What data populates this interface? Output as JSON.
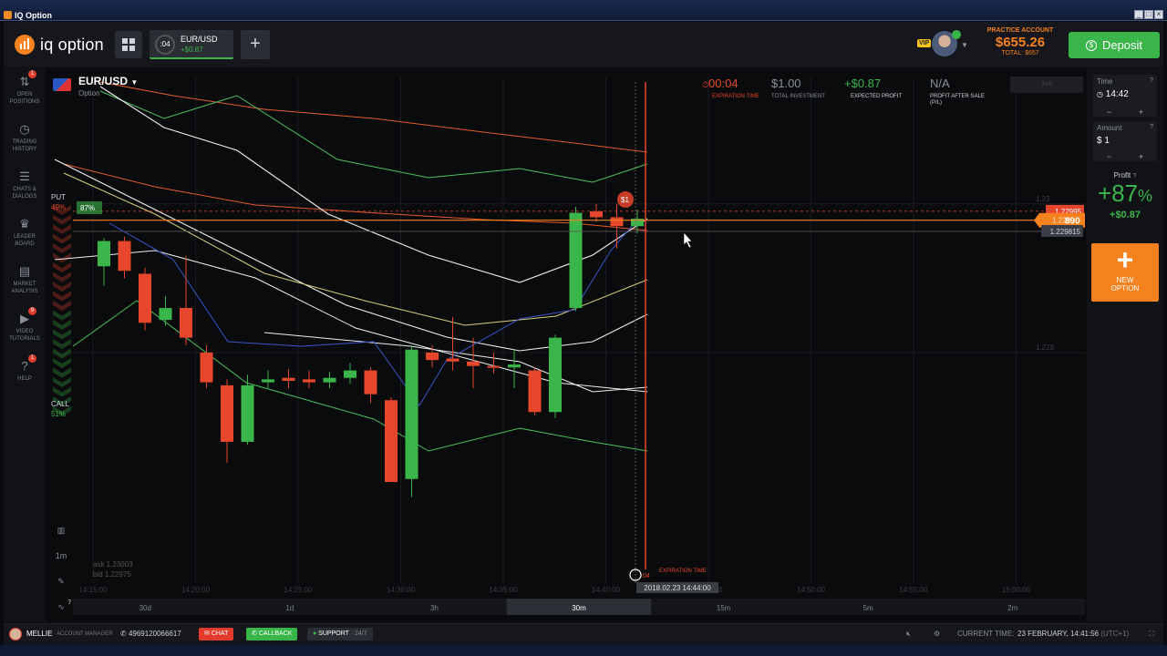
{
  "window": {
    "title": "IQ Option"
  },
  "header": {
    "logo_text": "iq option",
    "tab": {
      "timer": ":04",
      "pair": "EUR/USD",
      "pnl": "+$0.87"
    },
    "account": {
      "label": "PRACTICE ACCOUNT",
      "balance": "$655.26",
      "total": "TOTAL: $657"
    },
    "vip": "VIP",
    "deposit_label": "Deposit"
  },
  "sidebar": [
    {
      "label": "OPEN POSITIONS",
      "icon": "arrows-icon",
      "badge": "1"
    },
    {
      "label": "TRADING HISTORY",
      "icon": "clock-icon"
    },
    {
      "label": "CHATS & DIALOGS",
      "icon": "chat-icon"
    },
    {
      "label": "LEADER BOARD",
      "icon": "trophy-icon"
    },
    {
      "label": "MARKET ANALYSIS",
      "icon": "news-icon"
    },
    {
      "label": "VIDEO TUTORIALS",
      "icon": "play-icon",
      "badge": "9"
    },
    {
      "label": "HELP",
      "icon": "help-icon",
      "badge": "1"
    }
  ],
  "asset": {
    "name": "EUR/USD",
    "type": "Option"
  },
  "stats": {
    "expiration": {
      "value": "00:04",
      "label": "EXPIRATION TIME"
    },
    "investment": {
      "value": "$1.00",
      "label": "TOTAL INVESTMENT"
    },
    "expected": {
      "value": "+$0.87",
      "label": "EXPECTED PROFIT"
    },
    "after_sale": {
      "value": "N/A",
      "label": "PROFIT AFTER SALE (P/L)"
    },
    "sell_label": "Sell"
  },
  "sentiment": {
    "put": "PUT",
    "put_pct": "49%",
    "call": "CALL",
    "call_pct": "51%",
    "payout_tag": "87%"
  },
  "price_labels": {
    "high": "1.22995",
    "current_a": "1.229",
    "current_b": "890",
    "low": "1.229815",
    "axis_top": "1.23",
    "axis_bottom": "1.229"
  },
  "quote": {
    "ask": "ask 1.23003",
    "bid": "bid 1.22975"
  },
  "position_marker": "$1",
  "expiration_marker": {
    "timer": ":04",
    "label": "EXPIRATION TIME",
    "datetime": "2018.02.23 14:44:00"
  },
  "time_axis": [
    "14:15:00",
    "14:20:00",
    "14:25:00",
    "14:30:00",
    "14:35:00",
    "14:40:00",
    "14:45:00",
    "14:50:00",
    "14:55:00",
    "15:00:00"
  ],
  "periods": [
    {
      "label": "30d",
      "active": false
    },
    {
      "label": "1d",
      "active": false
    },
    {
      "label": "3h",
      "active": false
    },
    {
      "label": "30m",
      "active": true
    },
    {
      "label": "15m",
      "active": false
    },
    {
      "label": "5m",
      "active": false
    },
    {
      "label": "2m",
      "active": false
    }
  ],
  "chart_controls": {
    "interval": "1m",
    "indicator_badge": "7"
  },
  "right_panel": {
    "time": {
      "label": "Time",
      "value": "14:42"
    },
    "amount": {
      "label": "Amount",
      "value": "$ 1"
    },
    "profit": {
      "label": "Profit",
      "pct": "+87",
      "pct_sym": "%",
      "usd": "+$0.87"
    },
    "new_option": [
      "NEW",
      "OPTION"
    ]
  },
  "bottom": {
    "user": "MELLIE",
    "manager_label": "ACCOUNT MANAGER",
    "phone": "4969120066617",
    "chat": "CHAT",
    "callback": "CALLBACK",
    "support": "SUPPORT",
    "support_hours": "· 24/7",
    "current_time_label": "CURRENT TIME:",
    "current_time": "23 FEBRUARY, 14:41:56",
    "tz": "(UTC+1)"
  },
  "colors": {
    "up": "#3ab54a",
    "down": "#e6472c",
    "accent": "#f5821f"
  },
  "chart_data": {
    "type": "candlestick",
    "x_ticks": [
      "14:15:00",
      "14:20:00",
      "14:25:00",
      "14:30:00",
      "14:35:00",
      "14:40:00",
      "14:45:00",
      "14:50:00",
      "14:55:00",
      "15:00:00"
    ],
    "y_ticks": [
      "1.23",
      "1.229"
    ],
    "current_price": 1.22989,
    "candles": [
      {
        "o": 1.22958,
        "c": 1.22975,
        "h": 1.22977,
        "l": 1.22945,
        "d": 1
      },
      {
        "o": 1.22975,
        "c": 1.22955,
        "h": 1.22978,
        "l": 1.2295,
        "d": -1
      },
      {
        "o": 1.22953,
        "c": 1.2292,
        "h": 1.22957,
        "l": 1.22915,
        "d": -1
      },
      {
        "o": 1.22922,
        "c": 1.2293,
        "h": 1.22938,
        "l": 1.22918,
        "d": 1
      },
      {
        "o": 1.2293,
        "c": 1.2291,
        "h": 1.22965,
        "l": 1.22905,
        "d": -1
      },
      {
        "o": 1.229,
        "c": 1.2288,
        "h": 1.22905,
        "l": 1.22876,
        "d": -1
      },
      {
        "o": 1.22878,
        "c": 1.2284,
        "h": 1.22882,
        "l": 1.22826,
        "d": -1
      },
      {
        "o": 1.2284,
        "c": 1.22878,
        "h": 1.22885,
        "l": 1.22838,
        "d": 1
      },
      {
        "o": 1.2288,
        "c": 1.22882,
        "h": 1.22888,
        "l": 1.22876,
        "d": 1
      },
      {
        "o": 1.22883,
        "c": 1.22881,
        "h": 1.22889,
        "l": 1.22876,
        "d": -1
      },
      {
        "o": 1.22882,
        "c": 1.2288,
        "h": 1.22888,
        "l": 1.22876,
        "d": -1
      },
      {
        "o": 1.2288,
        "c": 1.22883,
        "h": 1.22887,
        "l": 1.22876,
        "d": 1
      },
      {
        "o": 1.22883,
        "c": 1.22888,
        "h": 1.22893,
        "l": 1.22879,
        "d": 1
      },
      {
        "o": 1.22888,
        "c": 1.22872,
        "h": 1.2289,
        "l": 1.22866,
        "d": -1
      },
      {
        "o": 1.22868,
        "c": 1.22813,
        "h": 1.2287,
        "l": 1.22813,
        "d": -1
      },
      {
        "o": 1.22815,
        "c": 1.22902,
        "h": 1.22905,
        "l": 1.22803,
        "d": 1
      },
      {
        "o": 1.229,
        "c": 1.22895,
        "h": 1.22905,
        "l": 1.2289,
        "d": -1
      },
      {
        "o": 1.22896,
        "c": 1.22894,
        "h": 1.22924,
        "l": 1.22888,
        "d": -1
      },
      {
        "o": 1.22894,
        "c": 1.22891,
        "h": 1.2291,
        "l": 1.22876,
        "d": -1
      },
      {
        "o": 1.22891,
        "c": 1.2289,
        "h": 1.229,
        "l": 1.22886,
        "d": -1
      },
      {
        "o": 1.2289,
        "c": 1.22892,
        "h": 1.22902,
        "l": 1.22876,
        "d": 1
      },
      {
        "o": 1.22888,
        "c": 1.2286,
        "h": 1.2289,
        "l": 1.22858,
        "d": -1
      },
      {
        "o": 1.2286,
        "c": 1.2291,
        "h": 1.22912,
        "l": 1.22856,
        "d": 1
      },
      {
        "o": 1.2293,
        "c": 1.22994,
        "h": 1.22998,
        "l": 1.22928,
        "d": 1
      },
      {
        "o": 1.22995,
        "c": 1.22991,
        "h": 1.23,
        "l": 1.22988,
        "d": -1
      },
      {
        "o": 1.22991,
        "c": 1.22985,
        "h": 1.23,
        "l": 1.2297,
        "d": -1
      },
      {
        "o": 1.22985,
        "c": 1.2299,
        "h": 1.22996,
        "l": 1.2298,
        "d": 1
      }
    ]
  }
}
